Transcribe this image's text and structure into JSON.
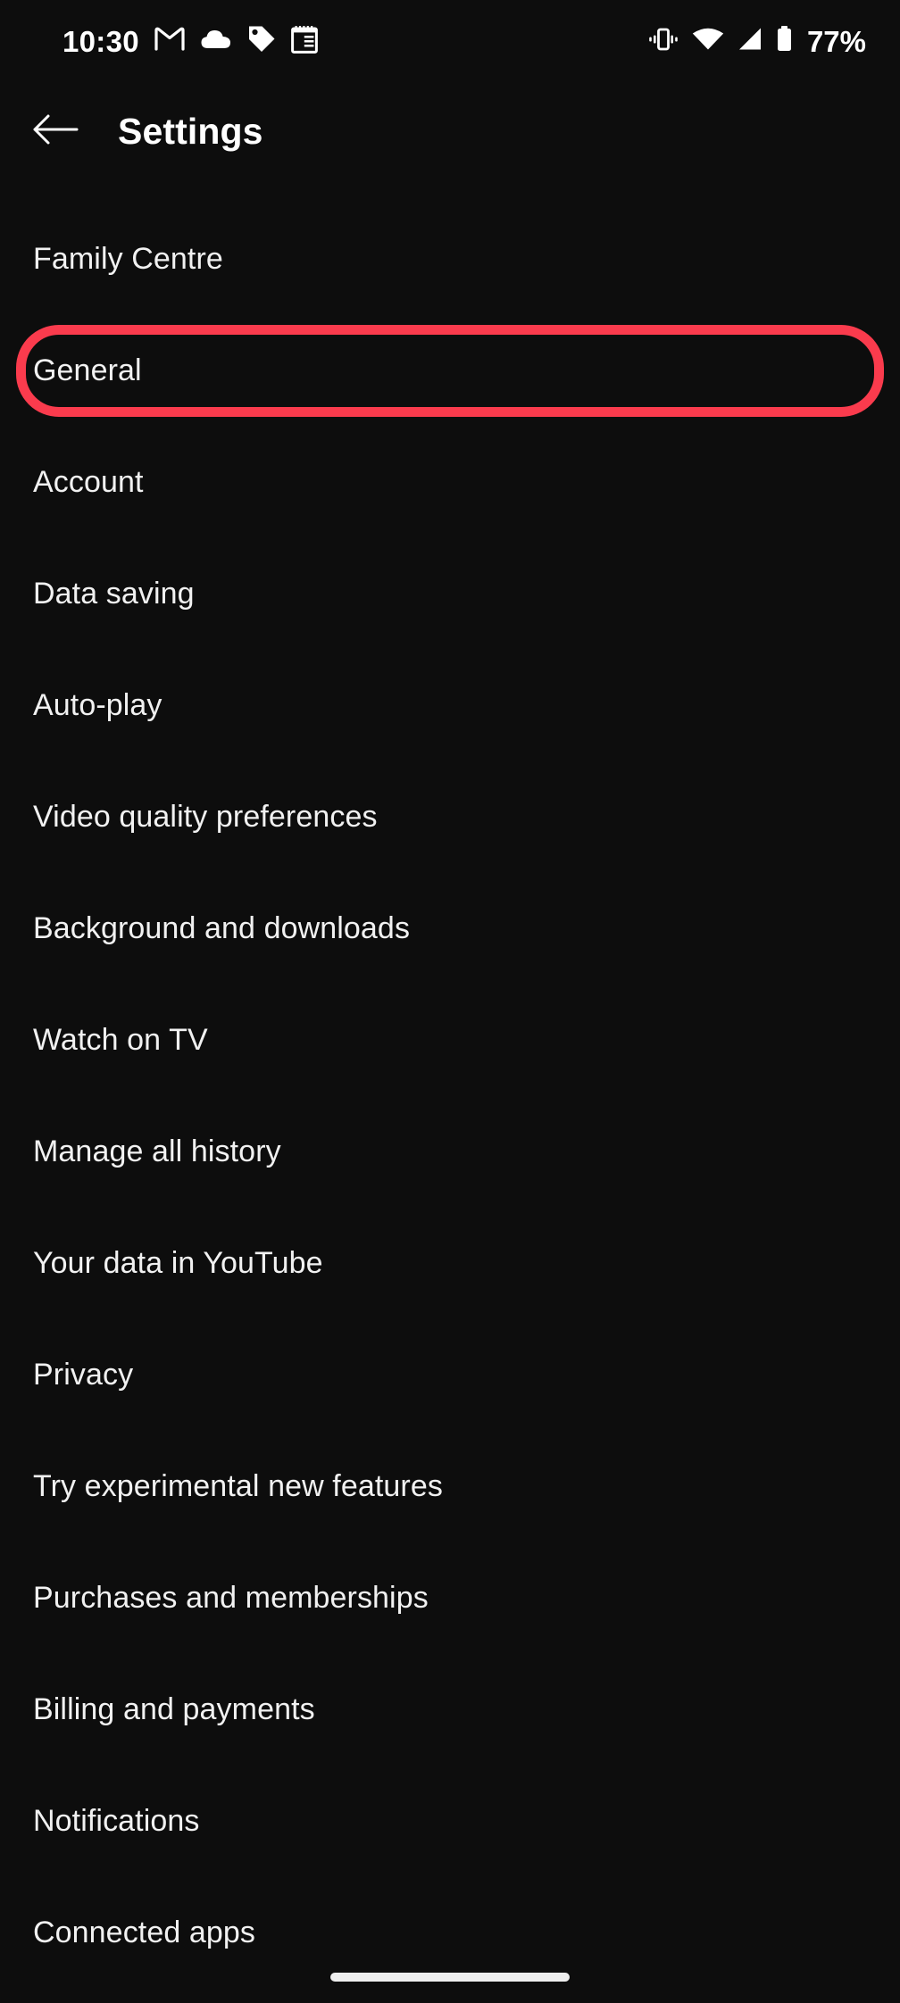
{
  "status_bar": {
    "time": "10:30",
    "battery_percent": "77%",
    "left_icons": [
      "gmail-icon",
      "cloud-icon",
      "tag-icon",
      "calendar-icon"
    ],
    "right_icons": [
      "vibrate-icon",
      "wifi-icon",
      "cellular-signal-icon",
      "battery-icon"
    ]
  },
  "app_bar": {
    "back_icon": "arrow-left-icon",
    "title": "Settings"
  },
  "settings": {
    "items": [
      {
        "label": "Family Centre",
        "highlighted": false
      },
      {
        "label": "General",
        "highlighted": true
      },
      {
        "label": "Account",
        "highlighted": false
      },
      {
        "label": "Data saving",
        "highlighted": false
      },
      {
        "label": "Auto-play",
        "highlighted": false
      },
      {
        "label": "Video quality preferences",
        "highlighted": false
      },
      {
        "label": "Background and downloads",
        "highlighted": false
      },
      {
        "label": "Watch on TV",
        "highlighted": false
      },
      {
        "label": "Manage all history",
        "highlighted": false
      },
      {
        "label": "Your data in YouTube",
        "highlighted": false
      },
      {
        "label": "Privacy",
        "highlighted": false
      },
      {
        "label": "Try experimental new features",
        "highlighted": false
      },
      {
        "label": "Purchases and memberships",
        "highlighted": false
      },
      {
        "label": "Billing and payments",
        "highlighted": false
      },
      {
        "label": "Notifications",
        "highlighted": false
      },
      {
        "label": "Connected apps",
        "highlighted": false
      }
    ]
  },
  "nav_bar": {
    "pill": "home-gesture-pill"
  },
  "colors": {
    "background": "#0d0d0d",
    "text": "#f1f1f1",
    "highlight": "#fa3b4d",
    "nav_pill": "#eeeeee"
  }
}
